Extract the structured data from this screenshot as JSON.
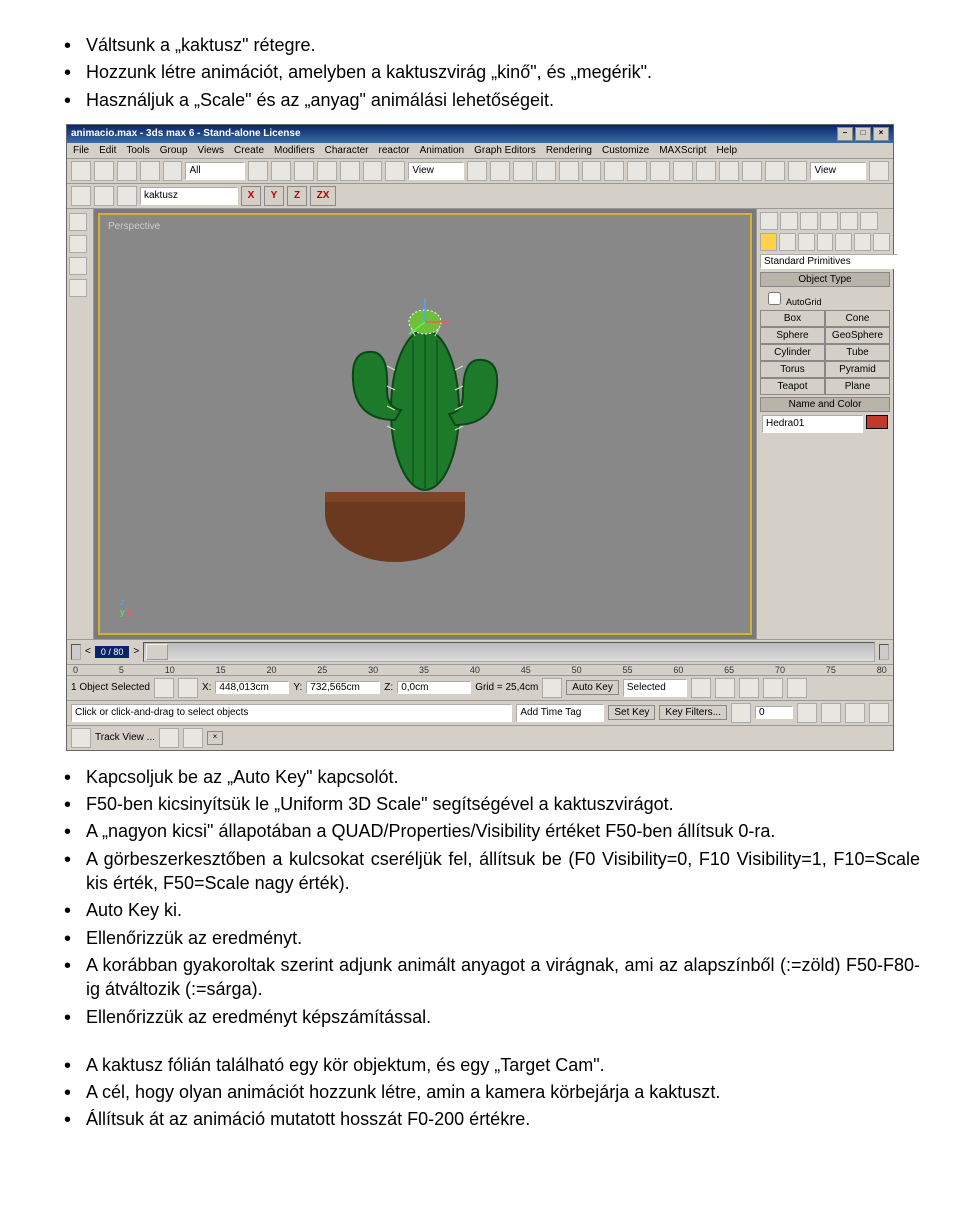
{
  "bullets_top": [
    "Váltsunk a „kaktusz\" rétegre.",
    "Hozzunk létre animációt, amelyben a kaktuszvirág „kinő\", és „megérik\".",
    "Használjuk a „Scale\" és az „anyag\" animálási lehetőségeit."
  ],
  "bullets_mid": [
    "Kapcsoljuk be az „Auto Key\" kapcsolót.",
    "F50-ben kicsinyítsük le „Uniform 3D Scale\" segítségével a kaktuszvirágot.",
    "A „nagyon kicsi\" állapotában a QUAD/Properties/Visibility értéket F50-ben állítsuk 0-ra.",
    "A görbeszerkesztőben a kulcsokat cseréljük fel, állítsuk be (F0 Visibility=0, F10 Visibility=1, F10=Scale kis érték, F50=Scale nagy érték).",
    "Auto Key ki.",
    "Ellenőrizzük az eredményt.",
    "A korábban gyakoroltak szerint adjunk animált anyagot a virágnak, ami az alapszínből (:=zöld)  F50-F80-ig átváltozik (:=sárga).",
    "Ellenőrizzük az eredményt képszámítással."
  ],
  "bullets_bot": [
    "A kaktusz fólián található egy kör objektum, és egy „Target Cam\".",
    "A cél, hogy olyan animációt hozzunk létre, amin a kamera körbejárja a kaktuszt.",
    "Állítsuk át az animáció mutatott hosszát F0-200 értékre."
  ],
  "shot": {
    "title": "animacio.max - 3ds max 6 - Stand-alone License",
    "menus": [
      "File",
      "Edit",
      "Tools",
      "Group",
      "Views",
      "Create",
      "Modifiers",
      "Character",
      "reactor",
      "Animation",
      "Graph Editors",
      "Rendering",
      "Customize",
      "MAXScript",
      "Help"
    ],
    "sel_dropdown": "All",
    "view_dropdown": "View",
    "obj_name": "kaktusz",
    "axes": {
      "x": "X",
      "y": "Y",
      "z": "Z",
      "zx": "ZX"
    },
    "viewport_label": "Perspective",
    "right": {
      "primitive_drop": "Standard Primitives",
      "section1": "Object Type",
      "autogrid": "AutoGrid",
      "btns": [
        [
          "Box",
          "Cone"
        ],
        [
          "Sphere",
          "GeoSphere"
        ],
        [
          "Cylinder",
          "Tube"
        ],
        [
          "Torus",
          "Pyramid"
        ],
        [
          "Teapot",
          "Plane"
        ]
      ],
      "section2": "Name and Color",
      "name_field": "Hedra01"
    },
    "frame_label": "0 / 80",
    "ticks": [
      "0",
      "5",
      "10",
      "15",
      "20",
      "25",
      "30",
      "35",
      "40",
      "45",
      "50",
      "55",
      "60",
      "65",
      "70",
      "75",
      "80"
    ],
    "status": {
      "sel": "1 Object Selected",
      "hint": "Click or click-and-drag to select objects",
      "x": "448,013cm",
      "xl": "X:",
      "y": "732,565cm",
      "yl": "Y:",
      "z": "0,0cm",
      "zl": "Z:",
      "grid": "Grid = 25,4cm",
      "addtag": "Add Time Tag",
      "autokey": "Auto Key",
      "setkey": "Set Key",
      "selected": "Selected",
      "keyfilters": "Key Filters...",
      "framefield": "0"
    },
    "trackview": "Track View ..."
  }
}
